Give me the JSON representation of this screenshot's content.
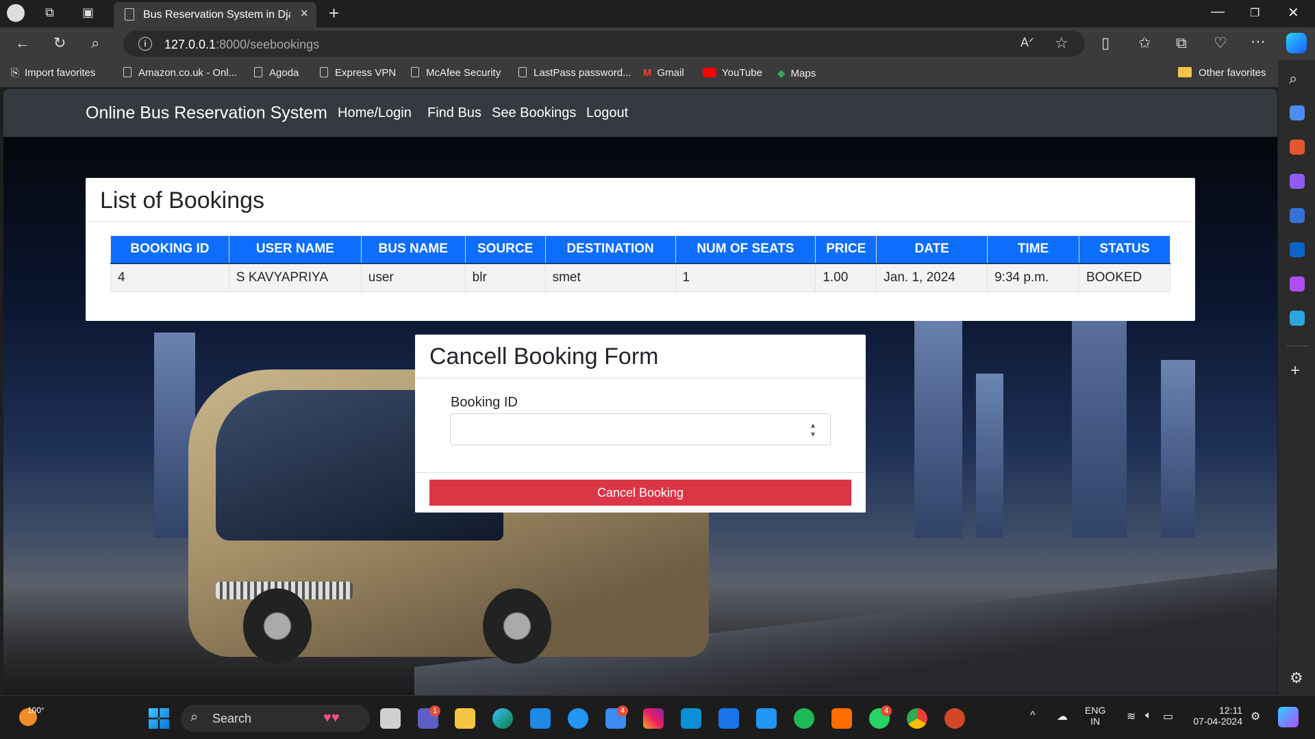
{
  "browser": {
    "tab_title": "Bus Reservation System in Djang",
    "url_host": "127.0.0.1",
    "url_rest": ":8000/seebookings",
    "favorites": [
      "Import favorites",
      "Amazon.co.uk - Onl...",
      "Agoda",
      "Express VPN",
      "McAfee Security",
      "LastPass password...",
      "Gmail",
      "YouTube",
      "Maps"
    ],
    "other_favorites": "Other favorites"
  },
  "navbar": {
    "brand": "Online Bus Reservation System",
    "links": [
      "Home/Login",
      "Find Bus",
      "See Bookings",
      "Logout"
    ]
  },
  "bookings": {
    "title": "List of Bookings",
    "headers": [
      "BOOKING ID",
      "USER NAME",
      "BUS NAME",
      "SOURCE",
      "DESTINATION",
      "NUM OF SEATS",
      "PRICE",
      "DATE",
      "TIME",
      "STATUS"
    ],
    "rows": [
      [
        "4",
        "S KAVYAPRIYA",
        "user",
        "blr",
        "smet",
        "1",
        "1.00",
        "Jan. 1, 2024",
        "9:34 p.m.",
        "BOOKED"
      ]
    ]
  },
  "cancel_form": {
    "title": "Cancell Booking Form",
    "label": "Booking ID",
    "value": "",
    "button": "Cancel Booking"
  },
  "taskbar": {
    "weather": "100°",
    "search": "Search",
    "lang1": "ENG",
    "lang2": "IN",
    "time": "12:11",
    "date": "07-04-2024",
    "badges": {
      "teams": "1",
      "mail": "4",
      "whatsapp": "4"
    }
  },
  "colors": {
    "navbar": "#343a40",
    "table_header": "#0d6efd",
    "danger": "#dc3545"
  }
}
